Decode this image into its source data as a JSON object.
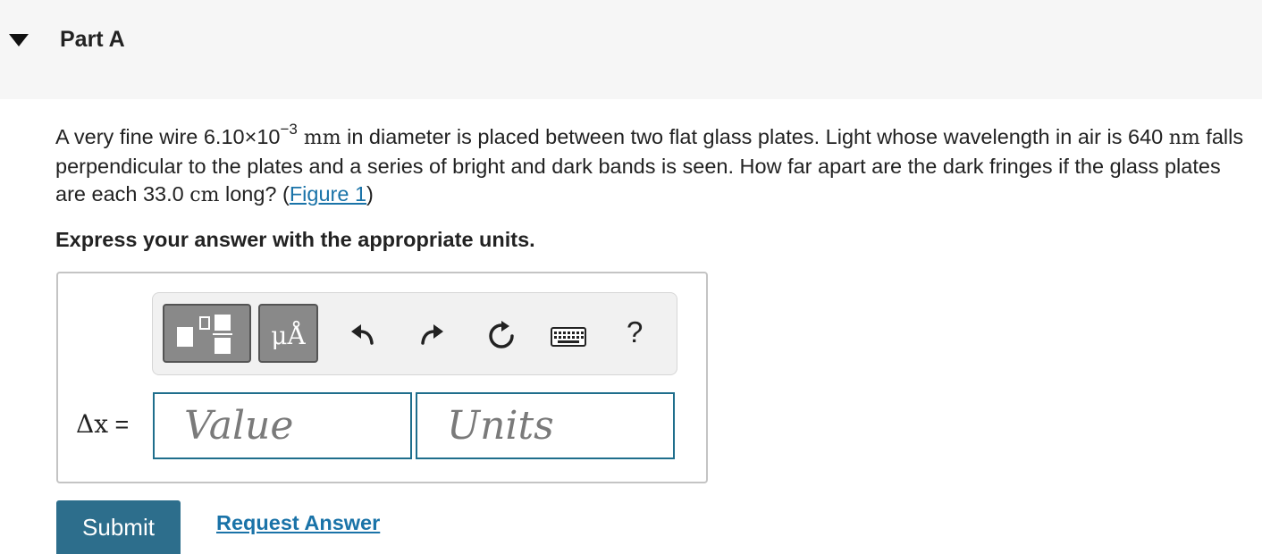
{
  "part": {
    "title": "Part A",
    "icon": "collapse-triangle-icon"
  },
  "question": {
    "t1": "A very fine wire 6.10×10",
    "exp": "−3",
    "u1": " mm",
    "t2": " in diameter is placed between two flat glass plates. Light whose wavelength in air is 640 ",
    "u2": "nm",
    "t3": " falls perpendicular to the plates and a series of bright and dark bands is seen. How far apart are the dark fringes if the glass plates are each 33.0 ",
    "u3": "cm",
    "t4": " long? (",
    "link": "Figure 1",
    "t5": ")"
  },
  "instruction": "Express your answer with the appropriate units.",
  "toolbar": {
    "templates_icon": "templates-icon",
    "units_label": "μÅ",
    "undo_icon": "undo-icon",
    "redo_icon": "redo-icon",
    "reset_icon": "reset-icon",
    "keyboard_icon": "keyboard-icon",
    "help_label": "?"
  },
  "answer": {
    "variable": "Δx",
    "equals": " =",
    "value_placeholder": "Value",
    "units_placeholder": "Units"
  },
  "actions": {
    "submit": "Submit",
    "request": "Request Answer"
  },
  "colors": {
    "header_bg": "#f6f6f6",
    "accent": "#2d6e8c",
    "link": "#1a73a8",
    "toolbar_btn": "#898989"
  }
}
